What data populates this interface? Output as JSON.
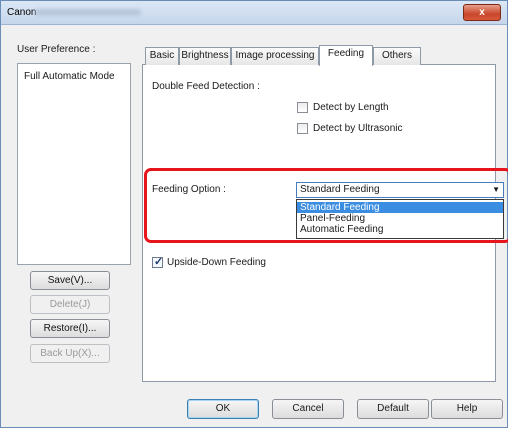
{
  "window": {
    "title": "Canon",
    "close_label": "x",
    "accent_color": "#e8141c",
    "selection_color": "#3a8de0"
  },
  "user_preference": {
    "label": "User Preference :",
    "items": [
      "Full Automatic Mode"
    ],
    "buttons": {
      "save": "Save(V)...",
      "delete": "Delete(J)",
      "restore": "Restore(I)...",
      "backup": "Back Up(X)..."
    }
  },
  "tabs": [
    "Basic",
    "Brightness",
    "Image processing",
    "Feeding",
    "Others"
  ],
  "active_tab": "Feeding",
  "feeding": {
    "double_feed_label": "Double Feed Detection :",
    "detect_length_label": "Detect by Length",
    "detect_length_checked": false,
    "detect_ultrasonic_label": "Detect by Ultrasonic",
    "detect_ultrasonic_checked": false,
    "feeding_option_label": "Feeding Option :",
    "feeding_option_value": "Standard Feeding",
    "feeding_options": [
      "Standard Feeding",
      "Panel-Feeding",
      "Automatic Feeding"
    ],
    "upside_down_label": "Upside-Down Feeding",
    "upside_down_checked": true
  },
  "footer": {
    "ok": "OK",
    "cancel": "Cancel",
    "default": "Default",
    "help": "Help"
  }
}
